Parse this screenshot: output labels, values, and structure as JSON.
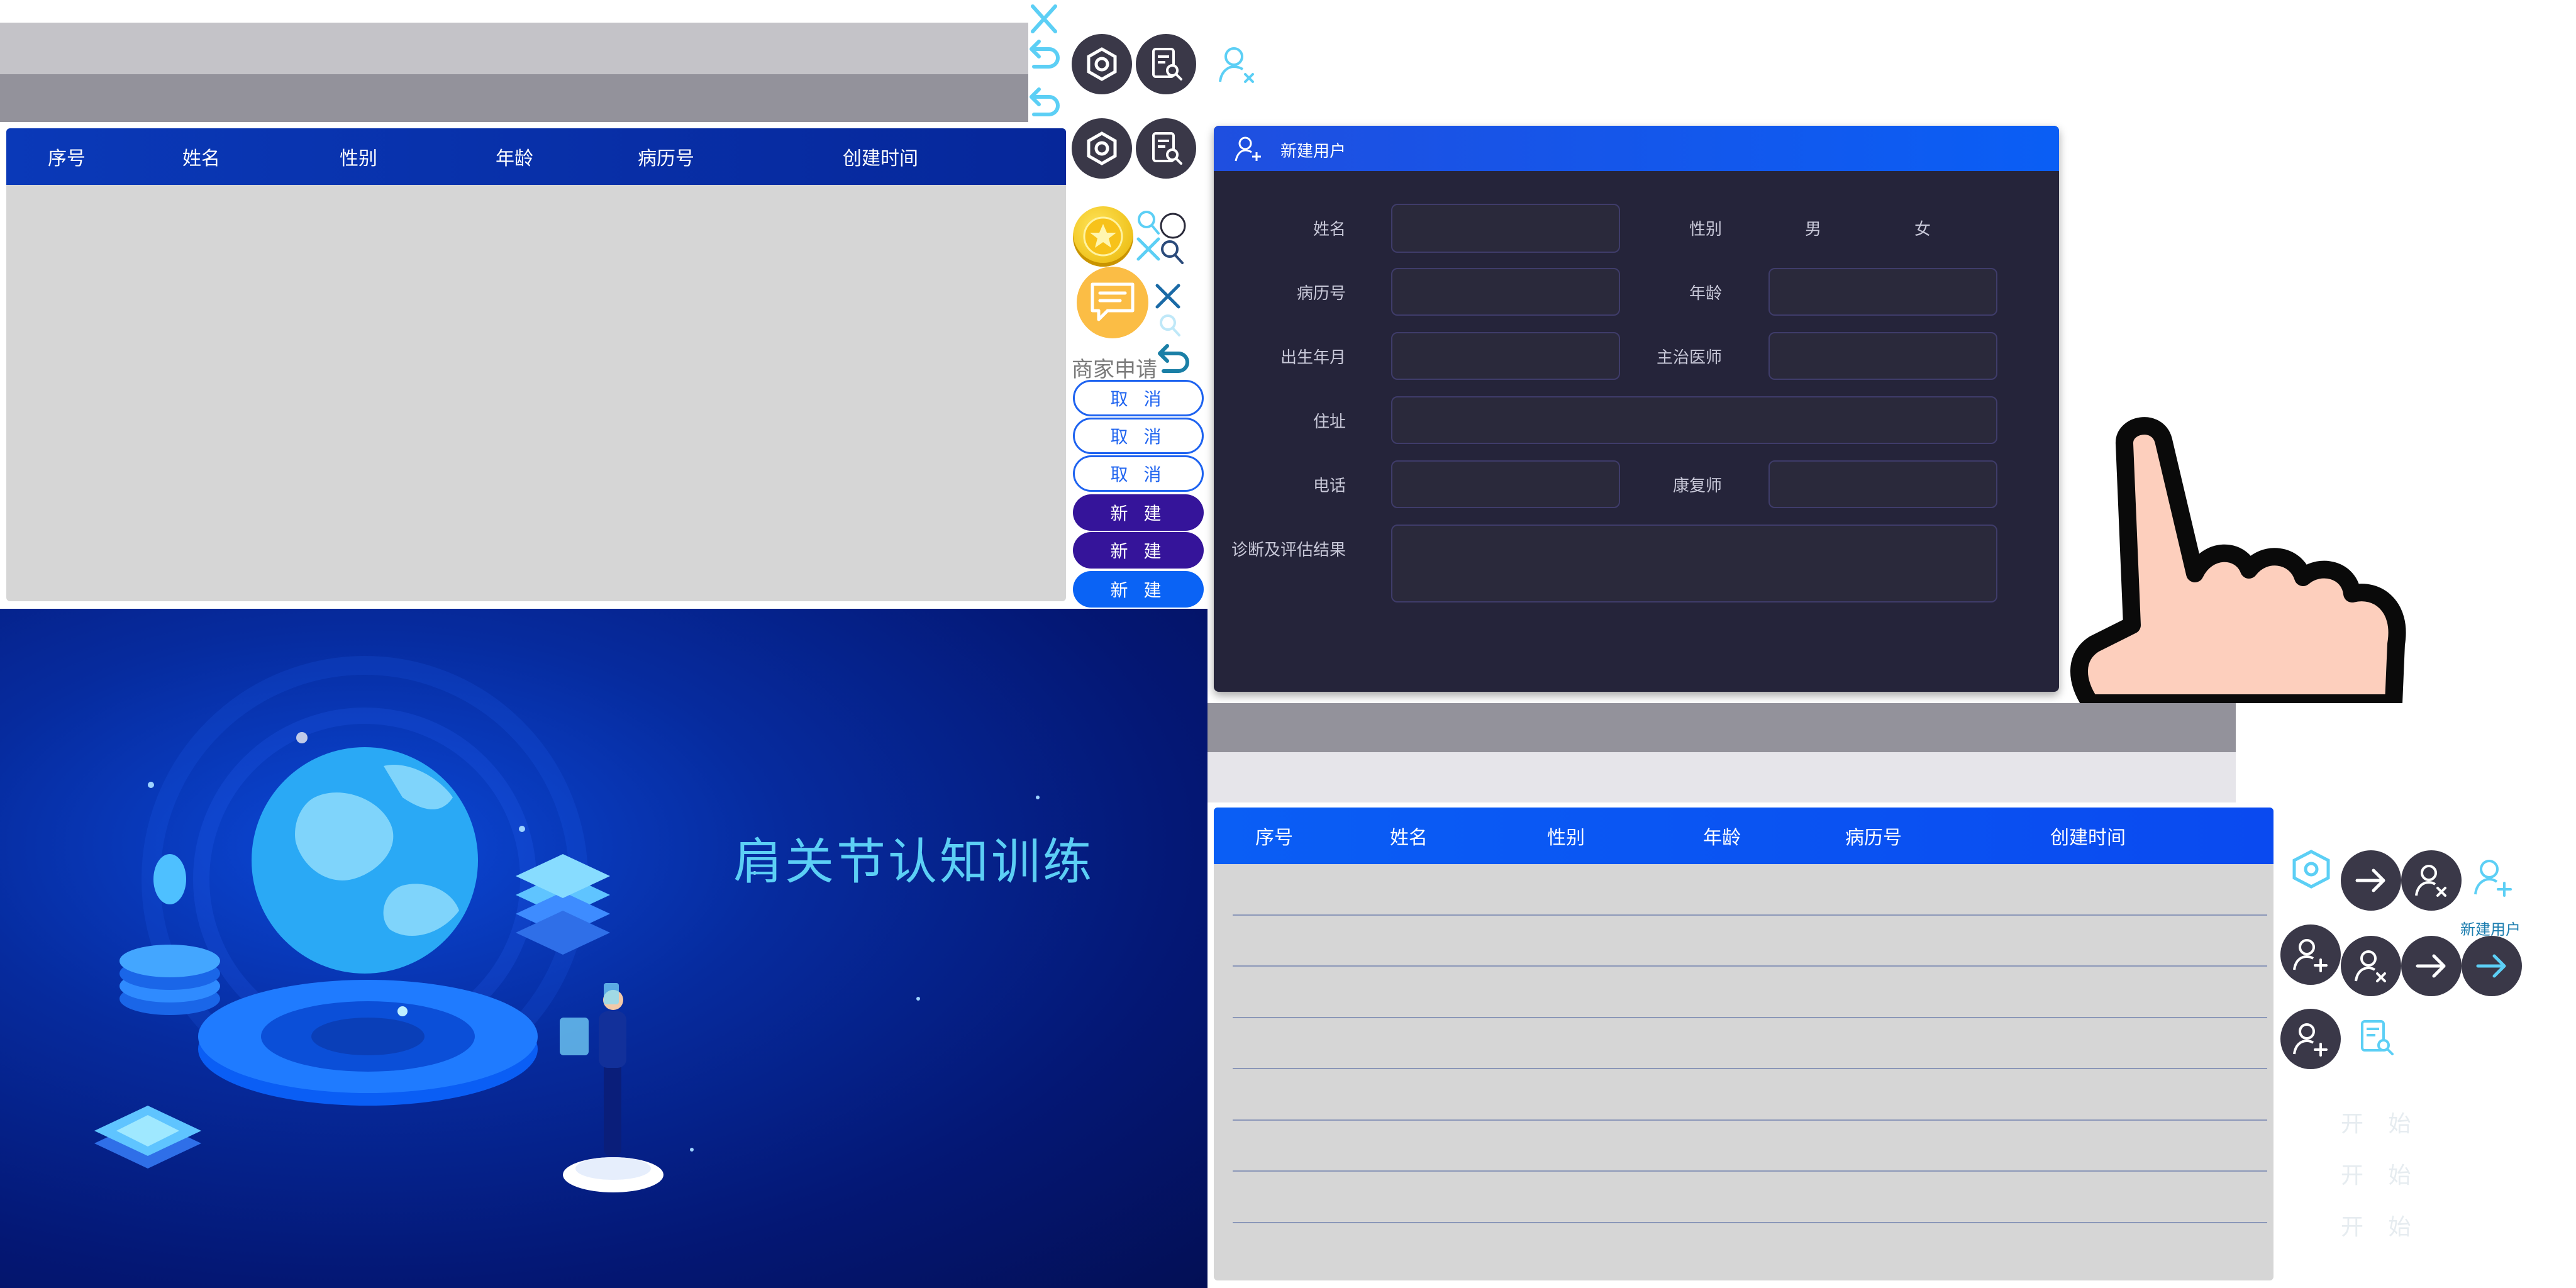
{
  "colors": {
    "header_blue": "#0a5ef5",
    "header_dark": "#0a2a9a",
    "panel_dark": "#25243a",
    "gray_light": "#c4c3c8",
    "gray_dark": "#93929b",
    "table_body": "#d6d6d6",
    "cyan": "#5ccff5",
    "purple": "#35149a"
  },
  "table_top": {
    "columns": [
      "序号",
      "姓名",
      "性别",
      "年龄",
      "病历号",
      "创建时间"
    ]
  },
  "table_bottom": {
    "columns": [
      "序号",
      "姓名",
      "性别",
      "年龄",
      "病历号",
      "创建时间"
    ]
  },
  "assets": {
    "merchant_label": "商家申请",
    "cancel": [
      "取 消",
      "取 消",
      "取 消"
    ],
    "create": [
      "新 建",
      "新 建",
      "新 建"
    ],
    "new_user_small": "新建用户",
    "start": [
      "开 始",
      "开 始",
      "开 始"
    ]
  },
  "form": {
    "title": "新建用户",
    "labels": {
      "name": "姓名",
      "gender": "性别",
      "record": "病历号",
      "age": "年龄",
      "birth": "出生年月",
      "doctor": "主治医师",
      "address": "住址",
      "phone": "电话",
      "therapist": "康复师",
      "diagnosis": "诊断及评估结果"
    },
    "gender_options": [
      "男",
      "女"
    ]
  },
  "banner": {
    "title": "肩关节认知训练"
  },
  "icons": [
    "close-icon",
    "undo-icon",
    "settings-icon",
    "report-search-icon",
    "user-remove-icon",
    "coin-star-icon",
    "search-icon",
    "chat-icon",
    "arrow-right-icon",
    "user-add-icon",
    "hand-pointer-icon"
  ]
}
